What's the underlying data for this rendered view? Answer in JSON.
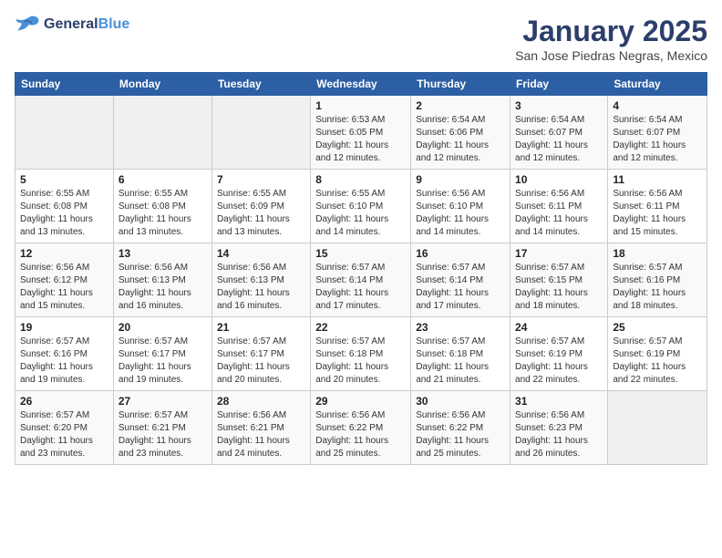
{
  "header": {
    "logo_line1": "General",
    "logo_line2": "Blue",
    "month": "January 2025",
    "location": "San Jose Piedras Negras, Mexico"
  },
  "days_of_week": [
    "Sunday",
    "Monday",
    "Tuesday",
    "Wednesday",
    "Thursday",
    "Friday",
    "Saturday"
  ],
  "weeks": [
    [
      {
        "day": "",
        "info": ""
      },
      {
        "day": "",
        "info": ""
      },
      {
        "day": "",
        "info": ""
      },
      {
        "day": "1",
        "info": "Sunrise: 6:53 AM\nSunset: 6:05 PM\nDaylight: 11 hours and 12 minutes."
      },
      {
        "day": "2",
        "info": "Sunrise: 6:54 AM\nSunset: 6:06 PM\nDaylight: 11 hours and 12 minutes."
      },
      {
        "day": "3",
        "info": "Sunrise: 6:54 AM\nSunset: 6:07 PM\nDaylight: 11 hours and 12 minutes."
      },
      {
        "day": "4",
        "info": "Sunrise: 6:54 AM\nSunset: 6:07 PM\nDaylight: 11 hours and 12 minutes."
      }
    ],
    [
      {
        "day": "5",
        "info": "Sunrise: 6:55 AM\nSunset: 6:08 PM\nDaylight: 11 hours and 13 minutes."
      },
      {
        "day": "6",
        "info": "Sunrise: 6:55 AM\nSunset: 6:08 PM\nDaylight: 11 hours and 13 minutes."
      },
      {
        "day": "7",
        "info": "Sunrise: 6:55 AM\nSunset: 6:09 PM\nDaylight: 11 hours and 13 minutes."
      },
      {
        "day": "8",
        "info": "Sunrise: 6:55 AM\nSunset: 6:10 PM\nDaylight: 11 hours and 14 minutes."
      },
      {
        "day": "9",
        "info": "Sunrise: 6:56 AM\nSunset: 6:10 PM\nDaylight: 11 hours and 14 minutes."
      },
      {
        "day": "10",
        "info": "Sunrise: 6:56 AM\nSunset: 6:11 PM\nDaylight: 11 hours and 14 minutes."
      },
      {
        "day": "11",
        "info": "Sunrise: 6:56 AM\nSunset: 6:11 PM\nDaylight: 11 hours and 15 minutes."
      }
    ],
    [
      {
        "day": "12",
        "info": "Sunrise: 6:56 AM\nSunset: 6:12 PM\nDaylight: 11 hours and 15 minutes."
      },
      {
        "day": "13",
        "info": "Sunrise: 6:56 AM\nSunset: 6:13 PM\nDaylight: 11 hours and 16 minutes."
      },
      {
        "day": "14",
        "info": "Sunrise: 6:56 AM\nSunset: 6:13 PM\nDaylight: 11 hours and 16 minutes."
      },
      {
        "day": "15",
        "info": "Sunrise: 6:57 AM\nSunset: 6:14 PM\nDaylight: 11 hours and 17 minutes."
      },
      {
        "day": "16",
        "info": "Sunrise: 6:57 AM\nSunset: 6:14 PM\nDaylight: 11 hours and 17 minutes."
      },
      {
        "day": "17",
        "info": "Sunrise: 6:57 AM\nSunset: 6:15 PM\nDaylight: 11 hours and 18 minutes."
      },
      {
        "day": "18",
        "info": "Sunrise: 6:57 AM\nSunset: 6:16 PM\nDaylight: 11 hours and 18 minutes."
      }
    ],
    [
      {
        "day": "19",
        "info": "Sunrise: 6:57 AM\nSunset: 6:16 PM\nDaylight: 11 hours and 19 minutes."
      },
      {
        "day": "20",
        "info": "Sunrise: 6:57 AM\nSunset: 6:17 PM\nDaylight: 11 hours and 19 minutes."
      },
      {
        "day": "21",
        "info": "Sunrise: 6:57 AM\nSunset: 6:17 PM\nDaylight: 11 hours and 20 minutes."
      },
      {
        "day": "22",
        "info": "Sunrise: 6:57 AM\nSunset: 6:18 PM\nDaylight: 11 hours and 20 minutes."
      },
      {
        "day": "23",
        "info": "Sunrise: 6:57 AM\nSunset: 6:18 PM\nDaylight: 11 hours and 21 minutes."
      },
      {
        "day": "24",
        "info": "Sunrise: 6:57 AM\nSunset: 6:19 PM\nDaylight: 11 hours and 22 minutes."
      },
      {
        "day": "25",
        "info": "Sunrise: 6:57 AM\nSunset: 6:19 PM\nDaylight: 11 hours and 22 minutes."
      }
    ],
    [
      {
        "day": "26",
        "info": "Sunrise: 6:57 AM\nSunset: 6:20 PM\nDaylight: 11 hours and 23 minutes."
      },
      {
        "day": "27",
        "info": "Sunrise: 6:57 AM\nSunset: 6:21 PM\nDaylight: 11 hours and 23 minutes."
      },
      {
        "day": "28",
        "info": "Sunrise: 6:56 AM\nSunset: 6:21 PM\nDaylight: 11 hours and 24 minutes."
      },
      {
        "day": "29",
        "info": "Sunrise: 6:56 AM\nSunset: 6:22 PM\nDaylight: 11 hours and 25 minutes."
      },
      {
        "day": "30",
        "info": "Sunrise: 6:56 AM\nSunset: 6:22 PM\nDaylight: 11 hours and 25 minutes."
      },
      {
        "day": "31",
        "info": "Sunrise: 6:56 AM\nSunset: 6:23 PM\nDaylight: 11 hours and 26 minutes."
      },
      {
        "day": "",
        "info": ""
      }
    ]
  ]
}
